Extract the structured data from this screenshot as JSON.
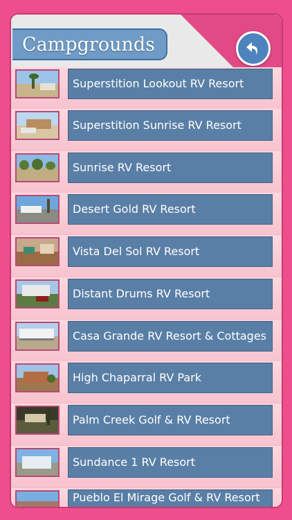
{
  "header": {
    "title": "Campgrounds",
    "back_icon": "back-arrow-icon"
  },
  "items": [
    {
      "label": "Superstition Lookout RV Resort"
    },
    {
      "label": "Superstition Sunrise RV Resort"
    },
    {
      "label": "Sunrise RV Resort"
    },
    {
      "label": "Desert Gold RV Resort"
    },
    {
      "label": "Vista Del Sol RV Resort"
    },
    {
      "label": "Distant Drums RV Resort"
    },
    {
      "label": "Casa Grande RV Resort & Cottages"
    },
    {
      "label": "High Chaparral RV Park"
    },
    {
      "label": "Palm Creek Golf & RV Resort"
    },
    {
      "label": "Sundance 1 RV Resort"
    },
    {
      "label": "Pueblo El Mirage Golf & RV Resort"
    }
  ]
}
